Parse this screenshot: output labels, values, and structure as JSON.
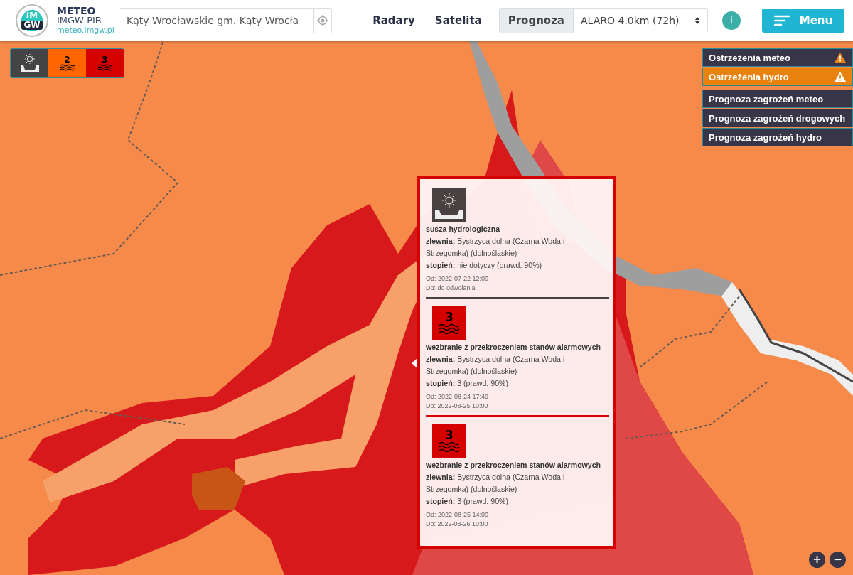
{
  "logo": {
    "mark_top": "IM",
    "mark_bottom": "GW",
    "title": "METEO",
    "subtitle": "IMGW-PIB",
    "url": "meteo.imgw.pl"
  },
  "search": {
    "value": "Kąty Wrocławskie gm. Kąty Wrocła"
  },
  "nav": [
    {
      "label": "Radary"
    },
    {
      "label": "Satelita"
    }
  ],
  "forecast": {
    "label": "Prognoza",
    "model": "ALARO 4.0km (72h)"
  },
  "info_button": "i",
  "menu_button": "Menu",
  "legend": [
    {
      "kind": "drought",
      "color": "#444444"
    },
    {
      "kind": "level",
      "label": "2",
      "color": "#ff6600"
    },
    {
      "kind": "level",
      "label": "3",
      "color": "#d50000"
    }
  ],
  "layers": [
    {
      "label": "Ostrzeżenia meteo",
      "warning": true,
      "selected": false
    },
    {
      "label": "Ostrzeżenia hydro",
      "warning": true,
      "selected": true
    },
    {
      "label": "Prognoza zagrożeń meteo",
      "warning": false,
      "selected": false
    },
    {
      "label": "Prognoza zagrożeń drogowych",
      "warning": false,
      "selected": false
    },
    {
      "label": "Prognoza zagrożeń hydro",
      "warning": false,
      "selected": false
    }
  ],
  "popup": {
    "warnings": [
      {
        "kind": "drought",
        "color": "#4a4242",
        "title": "susza hydrologiczna",
        "basin_label": "zlewnia:",
        "basin": "Bystrzyca dolna (Czarna Woda i Strzegomka) (dolnośląskie)",
        "degree_label": "stopień:",
        "degree": "nie dotyczy (prawd. 90%)",
        "from": "Od: 2022-07-22 12:00",
        "to": "Do: do odwołania"
      },
      {
        "kind": "level",
        "level_label": "3",
        "color": "#d50000",
        "title": "wezbranie z przekroczeniem stanów alarmowych",
        "basin_label": "zlewnia:",
        "basin": "Bystrzyca dolna (Czarna Woda i Strzegomka) (dolnośląskie)",
        "degree_label": "stopień:",
        "degree": "3 (prawd. 90%)",
        "from": "Od: 2022-08-24 17:49",
        "to": "Do: 2022-08-25 10:00"
      },
      {
        "kind": "level",
        "level_label": "3",
        "color": "#d50000",
        "title": "wezbranie z przekroczeniem stanów alarmowych",
        "basin_label": "zlewnia:",
        "basin": "Bystrzyca dolna (Czarna Woda i Strzegomka) (dolnośląskie)",
        "degree_label": "stopień:",
        "degree": "3 (prawd. 90%)",
        "from": "Od: 2022-08-25 14:00",
        "to": "Do: 2022-08-26 10:00"
      }
    ]
  },
  "zoom": {
    "in": "+",
    "out": "−"
  }
}
